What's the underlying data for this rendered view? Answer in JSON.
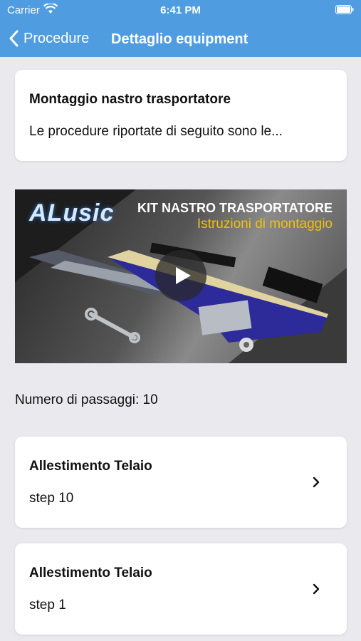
{
  "status_bar": {
    "carrier": "Carrier",
    "time": "6:41 PM"
  },
  "navbar": {
    "back_label": "Procedure",
    "title": "Dettaglio equipment"
  },
  "intro": {
    "title": "Montaggio nastro trasportatore",
    "description": "Le procedure riportate di seguito sono le..."
  },
  "video": {
    "brand": "ALusic",
    "title": "KIT NASTRO TRASPORTATORE",
    "subtitle": "Istruzioni di montaggio"
  },
  "step_count": "Numero di passaggi: 10",
  "steps": [
    {
      "title": "Allestimento Telaio",
      "subtitle": "step 10"
    },
    {
      "title": "Allestimento Telaio",
      "subtitle": "step 1"
    }
  ],
  "colors": {
    "header": "#4f9de0",
    "background": "#e9e9ee",
    "accent_yellow": "#f2c200"
  }
}
